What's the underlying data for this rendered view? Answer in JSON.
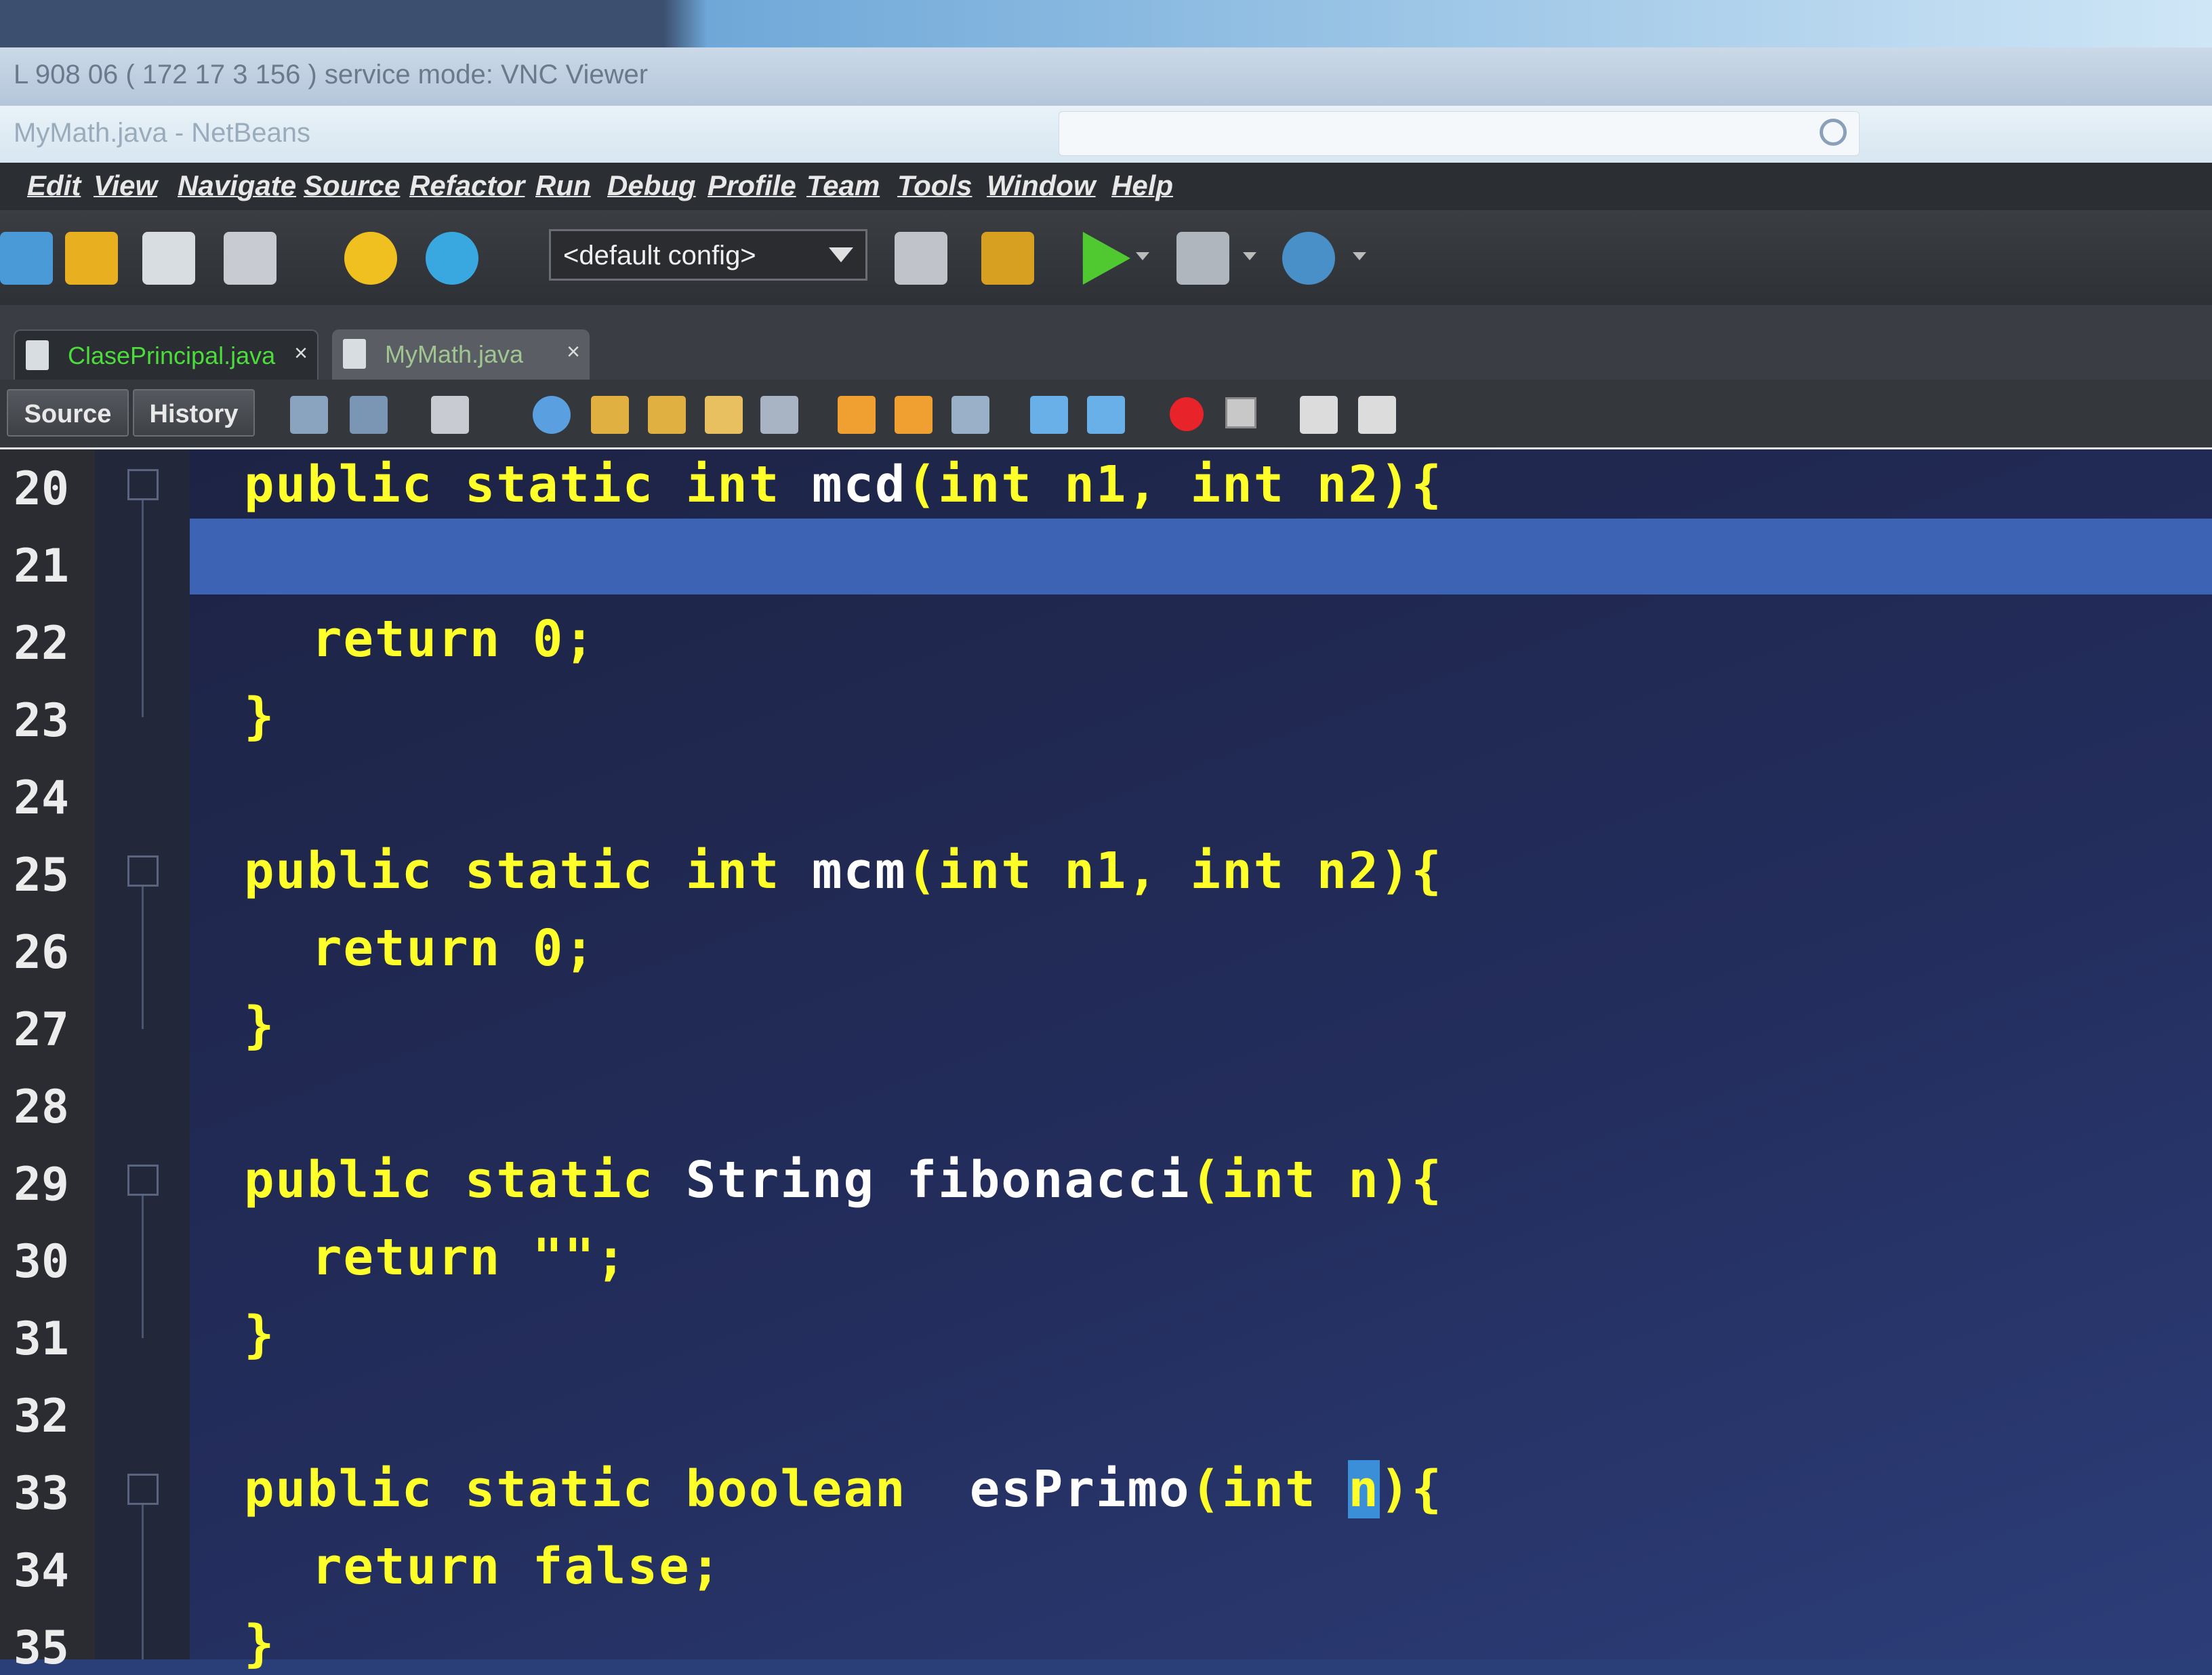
{
  "window": {
    "vnc_title": "L 908 06 ( 172 17 3 156 )  service mode: VNC Viewer",
    "ide_title": "MyMath.java - NetBeans"
  },
  "menu": [
    "Edit",
    "View",
    "Navigate",
    "Source",
    "Refactor",
    "Run",
    "Debug",
    "Profile",
    "Team",
    "Tools",
    "Window",
    "Help"
  ],
  "toolbar": {
    "config_value": "<default config>",
    "icons": [
      "new-file-icon",
      "open-project-icon",
      "close-project-icon",
      "save-all-icon",
      "undo-icon",
      "redo-icon",
      "build-hammer-icon",
      "clean-build-icon",
      "run-icon",
      "debug-icon",
      "profile-icon"
    ]
  },
  "tabs": [
    {
      "label": "ClasePrincipal.java",
      "close": "×",
      "active": true
    },
    {
      "label": "MyMath.java",
      "close": "×",
      "active": false
    }
  ],
  "editor_toolbar": {
    "source_label": "Source",
    "history_label": "History"
  },
  "editor": {
    "line_numbers": [
      "20",
      "21",
      "22",
      "23",
      "24",
      "25",
      "26",
      "27",
      "28",
      "29",
      "30",
      "31",
      "32",
      "33",
      "34",
      "35"
    ],
    "current_line": "21",
    "lines": {
      "l20_kw": "public static int ",
      "l20_fn": "mcd",
      "l20_rest": "(int n1, int n2){",
      "l22": "return 0;",
      "l23": "}",
      "l25_kw": "public static int ",
      "l25_fn": "mcm",
      "l25_rest": "(int n1, int n2){",
      "l26": "return 0;",
      "l27": "}",
      "l29_kw": "public static ",
      "l29_type": "String ",
      "l29_fn": "fibonacci",
      "l29_rest": "(int n){",
      "l30": "return \"\";",
      "l31": "}",
      "l33_kw": "public static boolean  ",
      "l33_fn": "esPrimo",
      "l33_rest1": "(int ",
      "l33_sel": "n",
      "l33_rest2": "){",
      "l34": "return false;",
      "l35": "}"
    }
  },
  "colors": {
    "keyword": "#ffff2a",
    "method_name": "#ffffff",
    "editor_bg": "#232d5c",
    "current_line": "#3d63b4",
    "tab_active_text": "#4cdc3c"
  }
}
